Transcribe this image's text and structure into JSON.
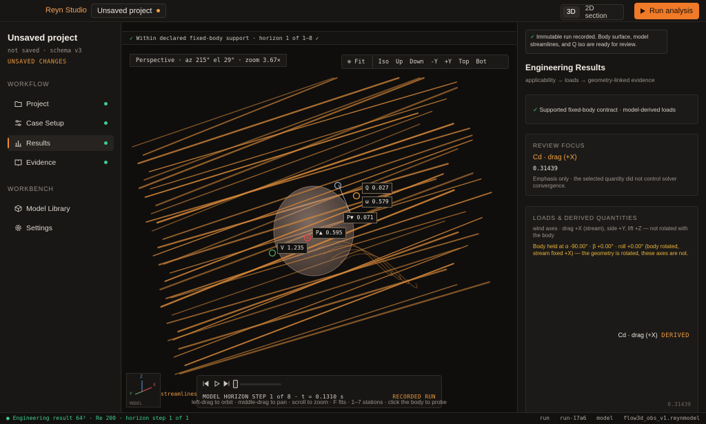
{
  "topbar": {
    "brand": "Reyn Studio",
    "project_chip": "Unsaved project",
    "view_3d": "3D",
    "view_2d": "2D section",
    "run_label": "Run analysis"
  },
  "sidebar": {
    "title": "Unsaved project",
    "subtitle": "not saved · schema v3",
    "unsaved": "UNSAVED CHANGES",
    "workflow_header": "WORKFLOW",
    "workbench_header": "WORKBENCH",
    "workflow_items": [
      "Project",
      "Case Setup",
      "Results",
      "Evidence"
    ],
    "workbench_items": [
      "Model Library",
      "Settings"
    ]
  },
  "viewport": {
    "banner_check": "✓",
    "banner_text": "Within declared fixed-body support · horizon 1 of 1–8 ✓",
    "camera": "Perspective  ·  az 215°  el  29°  ·  zoom 3.67×",
    "view_buttons": [
      "⊕ Fit",
      "Iso",
      "Up",
      "Down",
      "-Y",
      "+Y",
      "Top",
      "Bot"
    ],
    "probes": {
      "q": "Q 0.027",
      "w": "ω 0.579",
      "pv": "P▼ 0.071",
      "pa": "P▲ 0.595",
      "v": "V 1.235"
    },
    "gizmo": {
      "z": "Z",
      "x": "X",
      "y": "Y",
      "model": "MODEL"
    },
    "streamlines_tag": "streamlines",
    "playback": {
      "step": "MODEL HORIZON STEP 1 of 8 · t = 0.1310 s",
      "recorded": "RECORDED RUN"
    },
    "hint": "left-drag to orbit · middle-drag to pan · scroll to zoom · F fits · 1–7 stations · click the body to probe"
  },
  "rightpanel": {
    "notice_check": "✓",
    "notice": "Immutable run recorded. Body surface, model streamlines, and Q iso are ready for review.",
    "title": "Engineering Results",
    "subtitle": "applicability → loads → geometry-linked evidence",
    "contract_check": "✓",
    "contract": "Supported fixed-body contract · model-derived loads",
    "review": {
      "header": "REVIEW FOCUS",
      "quantity": "Cd · drag (+X)",
      "value": "0.31439",
      "note": "Emphasis only · the selected quantity did not control solver convergence."
    },
    "loads": {
      "header": "LOADS & DERIVED QUANTITIES",
      "axes": "wind axes · drag +X (stream), side +Y, lift +Z — not rotated with the body",
      "warning": "Body held at α -90.00° · β +0.00° · roll +0.00° (body rotated, stream fixed +X) — the geometry is rotated, these axes are not.",
      "readout": "Cd · drag (+X)",
      "readout_tag": "DERIVED",
      "cut_value": "0.31439"
    }
  },
  "statusbar": {
    "left": "● Engineering result 64³ · Re 200 · horizon step 1 of 1",
    "run_label": "run",
    "run_id": "run-17a6",
    "model_label": "model",
    "model_file": "flow3d_obs_v1.reynmodel"
  },
  "colors": {
    "accent": "#f07a28",
    "ok": "#3fcf8e",
    "warning": "#e9b43a",
    "streamline": "#d98a3a"
  }
}
